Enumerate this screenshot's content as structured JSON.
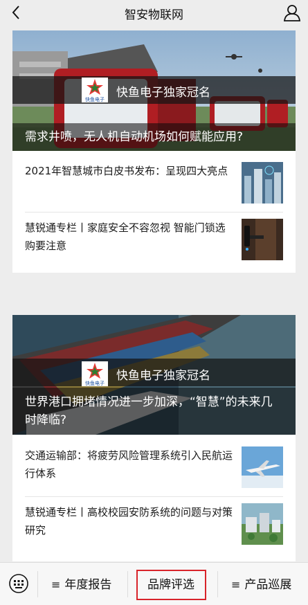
{
  "header": {
    "title": "智安物联网"
  },
  "cards": [
    {
      "badge": "快鱼电子独家冠名",
      "badge_logo_text": "快鱼电子",
      "headline": "需求井喷，无人机自动机场如何赋能应用?",
      "items": [
        {
          "text": "2021年智慧城市白皮书发布：呈现四大亮点",
          "thumb_icon": "smart-city-thumbnail"
        },
        {
          "text": "慧锐通专栏丨家庭安全不容忽视 智能门锁选购要注意",
          "thumb_icon": "smart-lock-thumbnail"
        }
      ]
    },
    {
      "badge": "快鱼电子独家冠名",
      "badge_logo_text": "快鱼电子",
      "headline": "世界港口拥堵情况进一步加深，“智慧”的未来几时降临?",
      "items": [
        {
          "text": "交通运输部：将疲劳风险管理系统引入民航运行体系",
          "thumb_icon": "airplane-thumbnail"
        },
        {
          "text": "慧锐通专栏丨高校校园安防系统的问题与对策研究",
          "thumb_icon": "campus-thumbnail"
        }
      ]
    }
  ],
  "bottom_menu": {
    "tabs": [
      {
        "label": "年度报告",
        "icon": "menu-icon"
      },
      {
        "label": "品牌评选"
      },
      {
        "label": "产品巡展",
        "icon": "menu-icon"
      }
    ],
    "highlight_color": "#d8232a"
  }
}
